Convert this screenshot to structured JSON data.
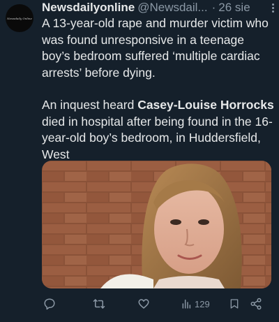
{
  "author": {
    "avatar_text": "Newsdaily Online",
    "name": "Newsdailyonline",
    "handle": "@Newsdail...",
    "separator": "·",
    "date": "26 sie"
  },
  "tweet": {
    "paragraph1": "A 13-year-old rape and murder victim who was found unresponsive in a teenage boy’s bedroom suffered ‘multiple cardiac arrests’ before dying.",
    "p2_before": "An inquest heard ",
    "p2_bold": "Casey-Louise Horrocks",
    "p2_after": " died in hospital after being found in the 16-year-old boy’s bedroom, in Huddersfield, West"
  },
  "actions": {
    "views_count": "129"
  },
  "icons": [
    "more-icon",
    "reply-icon",
    "retweet-icon",
    "like-icon",
    "views-icon",
    "bookmark-icon",
    "share-icon"
  ]
}
